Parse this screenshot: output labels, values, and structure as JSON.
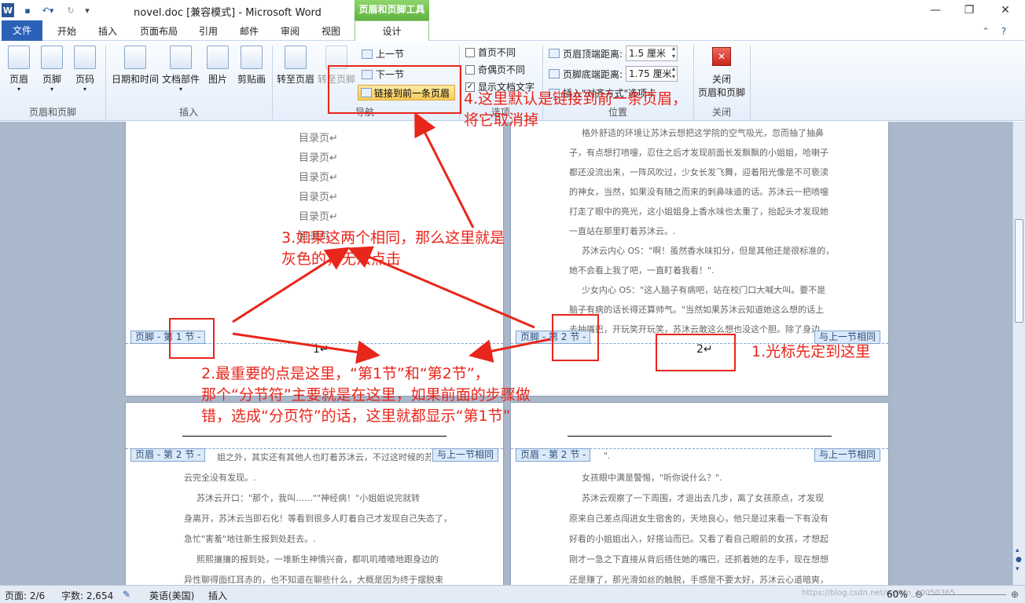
{
  "window": {
    "title": "novel.doc [兼容模式] - Microsoft Word",
    "tools_header": "页眉和页脚工具",
    "app_icon": "W"
  },
  "tabs": [
    "文件",
    "开始",
    "插入",
    "页面布局",
    "引用",
    "邮件",
    "审阅",
    "视图",
    "设计"
  ],
  "ribbon": {
    "header_footer": {
      "header": "页眉",
      "footer": "页脚",
      "page_number": "页码",
      "group": "页眉和页脚"
    },
    "insert": {
      "datetime": "日期和时间",
      "docparts": "文档部件",
      "picture": "图片",
      "clipart": "剪贴画",
      "group": "插入"
    },
    "nav": {
      "goto_header": "转至页眉",
      "goto_footer": "转至页脚",
      "prev": "上一节",
      "next": "下一节",
      "link_prev": "链接到前一条页眉",
      "group": "导航"
    },
    "options": {
      "diff_first": "首页不同",
      "diff_oddeven": "奇偶页不同",
      "show_text": "显示文档文字",
      "group": "选项"
    },
    "position": {
      "header_label": "页眉顶端距离:",
      "header_value": "1.5 厘米",
      "footer_label": "页脚底端距离:",
      "footer_value": "1.75 厘米",
      "insert_align": "插入\"对齐方式\"选项卡",
      "group": "位置"
    },
    "close": {
      "label1": "关闭",
      "label2": "页眉和页脚",
      "group": "关闭"
    }
  },
  "pages": {
    "toc_items": [
      "目录页↵",
      "目录页↵",
      "目录页↵",
      "目录页↵",
      "目录页↵",
      "目录页"
    ],
    "page2_lines": [
      "格外舒适的环境让苏沐云想把这学院的空气吸光，忽而抽了抽鼻",
      "子，有点想打喷嚏，忍住之后才发现前面长发飘飘的小姐姐，哈喇子",
      "都还没流出来，一阵风吹过，少女长发飞舞，迎着阳光像是不可亵渎",
      "的神女，当然，如果没有随之而来的刺鼻味道的话。苏沐云一把喷嚏",
      "打走了眼中的亮光，这小姐姐身上香水味也太重了，抬起头才发现她",
      "一直站在那里盯着苏沐云。.",
      "苏沐云内心 OS：\"啊！虽然香水味扣分，但是其他还是很标准的，",
      "她不会看上我了吧，一直盯着我看！\".",
      "少女内心 OS：\"这人脑子有病吧，站在校门口大喊大叫。要不是",
      "脑子有病的话长得还算帅气。\"当然如果苏沐云知道她这么想的话上",
      "去抽嘴巴，开玩笑开玩笑，苏沐云敢这么想也没这个胆。除了身边"
    ],
    "page3_lines": [
      "姐之外，其实还有其他人也盯着苏沐云，不过这时候的苏",
      "云完全没有发现。.",
      "苏沐云开口：\"那个，我叫……\"\"神经病！\"小姐姐说完就转",
      "身离开，苏沐云当即石化！等看到很多人盯着自己才发现自己失态了，",
      "急忙\"害羞\"地往新生报到处赶去。.",
      "熙熙攘攘的报到处，一堆新生神情兴奋，都叽叽喳喳地跟身边的",
      "异性聊得面红耳赤的，也不知道在聊些什么，大概是因为终于摆脱束"
    ],
    "page4_lines": [
      "\".",
      "女孩眼中满是警惕，\"听你说什么？\".",
      "苏沐云观察了一下周围，才退出去几步，离了女孩原点，才发现",
      "原来自己差点闯进女生宿舍的，天地良心，他只是过来看一下有没有",
      "好看的小姐姐出入，好搭讪而已。又看了看自己眼前的女孩，才想起",
      "刚才一急之下直接从背后捂住她的嘴巴，还抓着她的左手，现在想想",
      "还是赚了，那光滑如丝的触脱，手感是不要太好，苏沐云心道暗爽，"
    ],
    "footer_tag_1": "页脚 - 第 1 节 -",
    "footer_tag_2": "页脚 - 第 2 节 -",
    "header_tag_2": "页眉 - 第 2 节 -",
    "same_as_prev": "与上一节相同",
    "page_num_1": "1↵",
    "page_num_2": "2↵"
  },
  "annotations": {
    "a1": "1.光标先定到这里",
    "a2_l1": "2.最重要的点是这里，“第1节”和“第2节”，",
    "a2_l2": "那个“分节符”主要就是在这里，如果前面的步骤做",
    "a2_l3": "错，选成“分页符”的话，这里就都显示“第1节”",
    "a3_l1": "3.如果这两个相同，那么这里就是",
    "a3_l2": "灰色的，无法点击",
    "a4_l1": "4.这里默认是链接到前一条页眉，",
    "a4_l2": "将它取消掉",
    "color": "#e8261b"
  },
  "statusbar": {
    "page": "页面: 2/6",
    "words": "字数: 2,654",
    "lang": "英语(美国)",
    "mode": "插入",
    "zoom": "60%",
    "watermark": "https://blog.csdn.net/weixin_40050365"
  }
}
